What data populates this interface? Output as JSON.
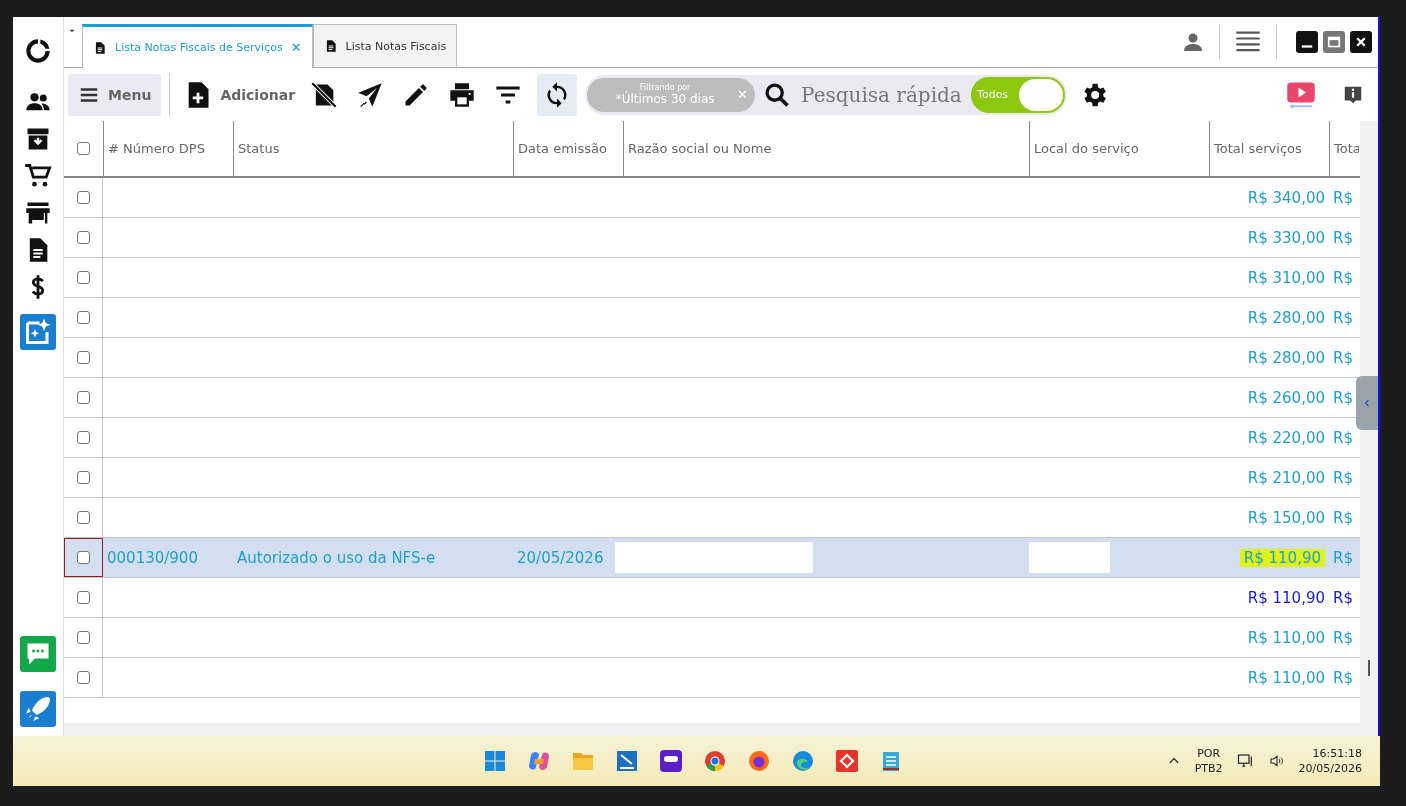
{
  "tabs": [
    {
      "label": "Lista Notas Fiscais de Serviços",
      "selected": true,
      "close": "✕"
    },
    {
      "label": "Lista Notas Fiscais",
      "selected": false
    }
  ],
  "toolbar": {
    "menu_label": "Menu",
    "add_label": "Adicionar",
    "sync_active": true,
    "filter": {
      "caption": "Filtrando por",
      "value": "*Últimos 30 dias",
      "clear": "✕"
    },
    "search": {
      "placeholder": "Pesquisa rápida"
    },
    "toggle": {
      "label": "Todos",
      "on": true
    }
  },
  "table": {
    "header_checked": false,
    "columns": [
      "# Número DPS",
      "Status",
      "Data emissão",
      "Razão social ou Nome",
      "Local do serviço",
      "Total serviços",
      "Tota"
    ],
    "rows": [
      {
        "checked": false,
        "selected": false,
        "total": "R$ 340,00",
        "total_2": "R$",
        "color": "#1ea0c8"
      },
      {
        "checked": false,
        "selected": false,
        "total": "R$ 330,00",
        "total_2": "R$",
        "color": "#1ea0c8"
      },
      {
        "checked": false,
        "selected": false,
        "total": "R$ 310,00",
        "total_2": "R$",
        "color": "#1ea0c8"
      },
      {
        "checked": false,
        "selected": false,
        "total": "R$ 280,00",
        "total_2": "R$",
        "color": "#1ea0c8"
      },
      {
        "checked": false,
        "selected": false,
        "total": "R$ 280,00",
        "total_2": "R$",
        "color": "#1ea0c8"
      },
      {
        "checked": false,
        "selected": false,
        "total": "R$ 260,00",
        "total_2": "R$",
        "color": "#1ea0c8"
      },
      {
        "checked": false,
        "selected": false,
        "total": "R$ 220,00",
        "total_2": "R$",
        "color": "#1ea0c8"
      },
      {
        "checked": false,
        "selected": false,
        "total": "R$ 210,00",
        "total_2": "R$",
        "color": "#1ea0c8"
      },
      {
        "checked": false,
        "selected": false,
        "total": "R$ 150,00",
        "total_2": "R$",
        "color": "#1ea0c8"
      },
      {
        "checked": false,
        "selected": true,
        "number": "000130/900",
        "status": "Autorizado o uso da NFS-e",
        "date": "20/05/2026",
        "redacted": true,
        "highlighted": true,
        "total": "R$ 110,90",
        "total_2": "R$",
        "color": "#1ea0c8"
      },
      {
        "checked": false,
        "selected": false,
        "total": "R$ 110,90",
        "total_2": "R$",
        "color": "#1a1ad2"
      },
      {
        "checked": false,
        "selected": false,
        "total": "R$ 110,00",
        "total_2": "R$",
        "color": "#1ea0c8"
      },
      {
        "checked": false,
        "selected": false,
        "total": "R$ 110,00",
        "total_2": "R$",
        "color": "#1ea0c8"
      }
    ]
  },
  "taskbar": {
    "language": "POR",
    "layout": "PTB2",
    "time": "16:51:18",
    "date": "20/05/2026"
  }
}
